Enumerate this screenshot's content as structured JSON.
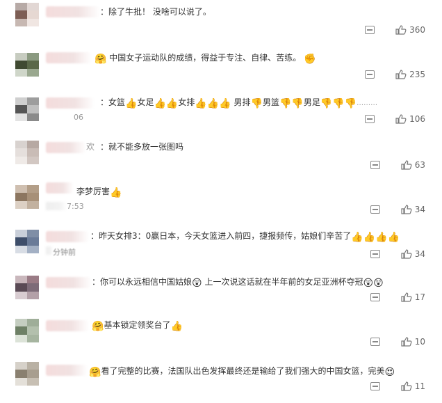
{
  "comments": [
    {
      "text": "：除了牛批！ 没啥可以说了。",
      "likes": "360",
      "colors": [
        "#b7aaa6",
        "#e2d7d4",
        "#7d5e55",
        "#e6d8d2",
        "#c7b8b2",
        "#f0e6e2"
      ]
    },
    {
      "text": "中国女子运动队的成绩，得益于专注、自律、苦练。",
      "likes": "235",
      "colors": [
        "#c7ccc0",
        "#8b9a80",
        "#404a32",
        "#5a6848",
        "#cfd6c9",
        "#9aa88f"
      ]
    },
    {
      "prefix": "：女篮",
      "mid1": "女足",
      "mid2": "女排",
      "mid3": "男排",
      "mid4": "男篮",
      "mid5": "男足",
      "ellipsis": "………",
      "time_frag": "06",
      "likes": "106",
      "colors": [
        "#cfcfcf",
        "#9d9d9d",
        "#555555",
        "#bfbfbf",
        "#e3e3e3",
        "#8a8a8a"
      ]
    },
    {
      "name_frag": "欢",
      "text": "：就不能多放一张图吗",
      "likes": "63",
      "colors": [
        "#d8d2cf",
        "#b7a9a3",
        "#e5dfdc",
        "#c9bcb6",
        "#efeae7",
        "#d2c7c2"
      ]
    },
    {
      "text": "李梦厉害",
      "time_frag": "7:53",
      "likes": "34",
      "colors": [
        "#cfbfb0",
        "#b39e88",
        "#8c7660",
        "#a79078",
        "#dcd0c4",
        "#c2b19f"
      ]
    },
    {
      "text": "：昨天女排3：0赢日本，今天女篮进入前四，捷报频传，姑娘们辛苦了",
      "time_frag": "分钟前",
      "likes": "34",
      "colors": [
        "#c9cfd9",
        "#7f8ea6",
        "#3e4e6a",
        "#6a7b98",
        "#d8dde5",
        "#a3b0c4"
      ]
    },
    {
      "text": "：你可以永远相信中国姑娘",
      "text2": "上一次说这话就在半年前的女足亚洲杯夺冠",
      "likes": "17",
      "colors": [
        "#c9b7bc",
        "#9a7b85",
        "#5a4a55",
        "#7d6b78",
        "#d8ccd1",
        "#b3a0a8"
      ]
    },
    {
      "text": "基本锁定领奖台了",
      "likes": "10",
      "colors": [
        "#c5cec1",
        "#9fae99",
        "#6e8066",
        "#b3c0ad",
        "#dce3d8",
        "#a6b5a0"
      ]
    },
    {
      "text": "看了完整的比赛，法国队出色发挥最终还是输给了我们强大的中国女篮，完美",
      "likes": "11",
      "colors": [
        "#d6d1c9",
        "#b9b1a4",
        "#8a8070",
        "#a89e8f",
        "#e4e0d9",
        "#c7bfb3"
      ]
    }
  ],
  "icons": {
    "reply": "comment-icon",
    "like": "thumbs-up-icon",
    "thumb_emoji": "👍",
    "thumb_down_emoji": "👎",
    "hug_emoji": "🤗",
    "fist_emoji": "✊",
    "wow_emoji": "😲",
    "face_emoji": "😍"
  },
  "accent": "#f0b232"
}
